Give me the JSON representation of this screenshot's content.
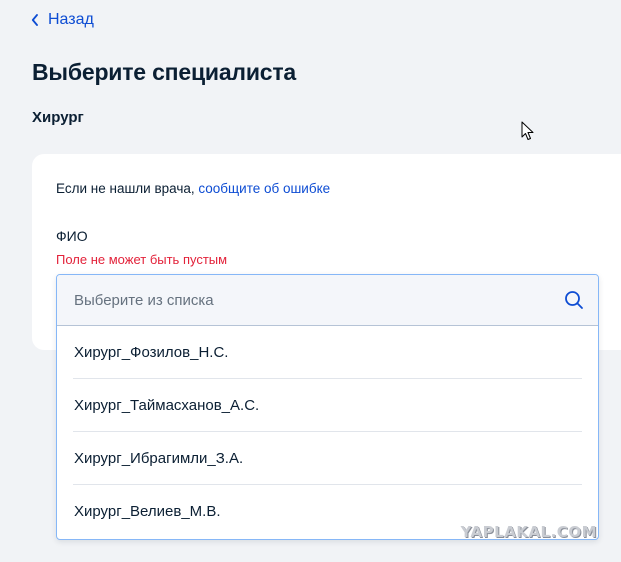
{
  "nav": {
    "back_label": "Назад"
  },
  "page": {
    "title": "Выберите специалиста",
    "specialty": "Хирург"
  },
  "form": {
    "not_found_text": "Если не нашли врача, ",
    "report_link": "сообщите об ошибке",
    "field_label": "ФИО",
    "field_error": "Поле не может быть пустым",
    "search_placeholder": "Выберите из списка",
    "options": [
      "Хирург_Фозилов_Н.С.",
      "Хирург_Таймасханов_А.С.",
      "Хирург_Ибрагимли_З.А.",
      "Хирург_Велиев_М.В."
    ]
  },
  "icons": {
    "back": "chevron-left-icon",
    "search": "search-icon",
    "cursor": "mouse-pointer-icon"
  },
  "colors": {
    "accent": "#0d4cd3",
    "error": "#e3223a",
    "background": "#f1f3f6"
  },
  "watermark": "YAPLAKAL.COM"
}
